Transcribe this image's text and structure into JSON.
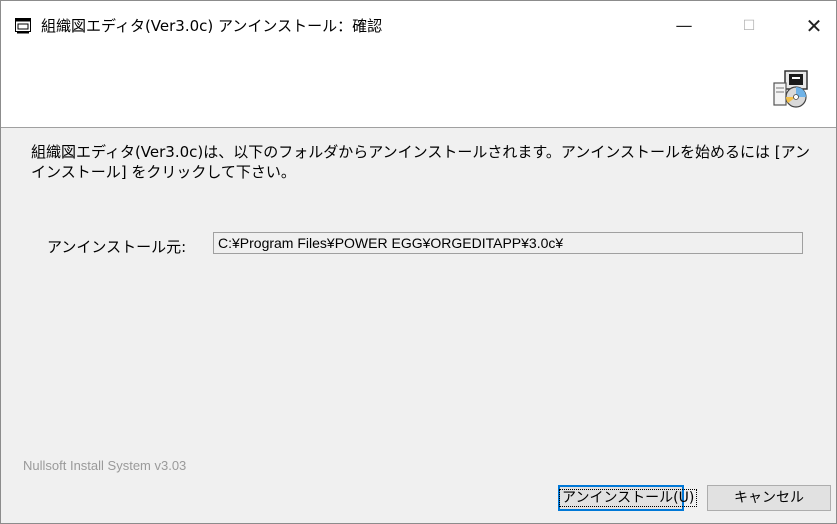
{
  "window": {
    "title": "組織図エディタ(Ver3.0c) アンインストール：確認",
    "minimize_glyph": "—",
    "maximize_glyph": "☐",
    "close_glyph": "✕"
  },
  "header": {
    "icon": "installer-icon"
  },
  "main": {
    "message": "組織図エディタ(Ver3.0c)は、以下のフォルダからアンインストールされます。アンインストールを始めるには [アンインストール] をクリックして下さい。",
    "uninstall_from_label": "アンインストール元:",
    "uninstall_from_value": "C:¥Program Files¥POWER EGG¥ORGEDITAPP¥3.0c¥"
  },
  "footer": {
    "branding": "Nullsoft Install System v3.03",
    "uninstall_button": "アンインストール(U)",
    "cancel_button": "キャンセル"
  },
  "colors": {
    "focus_border": "#0078d7",
    "dialog_bg": "#f0f0f0"
  }
}
